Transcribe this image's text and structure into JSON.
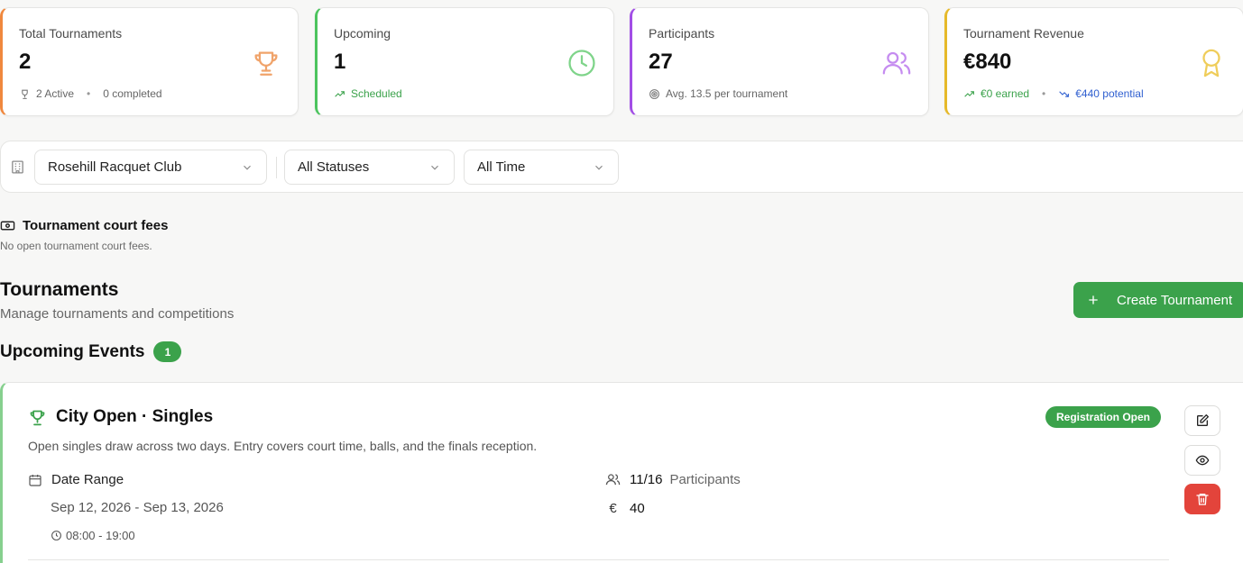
{
  "stats": [
    {
      "label": "Total Tournaments",
      "value": "2",
      "icon": "trophy-icon",
      "accent": "#f0883e",
      "sub_a": "2 Active",
      "sub_b": "0 completed"
    },
    {
      "label": "Upcoming",
      "value": "1",
      "icon": "clock-icon",
      "accent": "#4cc45e",
      "sub_a": "Scheduled"
    },
    {
      "label": "Participants",
      "value": "27",
      "icon": "users-icon",
      "accent": "#a24ee6",
      "sub_a": "Avg. 13.5 per tournament"
    },
    {
      "label": "Tournament Revenue",
      "value": "€840",
      "icon": "award-icon",
      "accent": "#e6b92a",
      "sub_a": "€0 earned",
      "sub_b": "€440 potential"
    }
  ],
  "filters": {
    "club": "Rosehill Racquet Club",
    "status": "All Statuses",
    "time": "All Time"
  },
  "fees": {
    "title": "Tournament court fees",
    "empty": "No open tournament court fees."
  },
  "tournaments": {
    "title": "Tournaments",
    "subtitle": "Manage tournaments and competitions",
    "create_label": "Create Tournament"
  },
  "upcoming": {
    "title": "Upcoming Events",
    "count": "1"
  },
  "event": {
    "title": "City Open · Singles",
    "description": "Open singles draw across two days. Entry covers court time, balls, and the finals reception.",
    "status": "Registration Open",
    "date_label": "Date Range",
    "date_range": "Sep 12, 2026 - Sep 13, 2026",
    "time_range": "08:00 - 19:00",
    "participants_count": "11/16",
    "participants_label": "Participants",
    "fee": "40"
  },
  "colors": {
    "green": "#3ba24b",
    "red": "#e3443b",
    "blue": "#2f5fd0"
  }
}
